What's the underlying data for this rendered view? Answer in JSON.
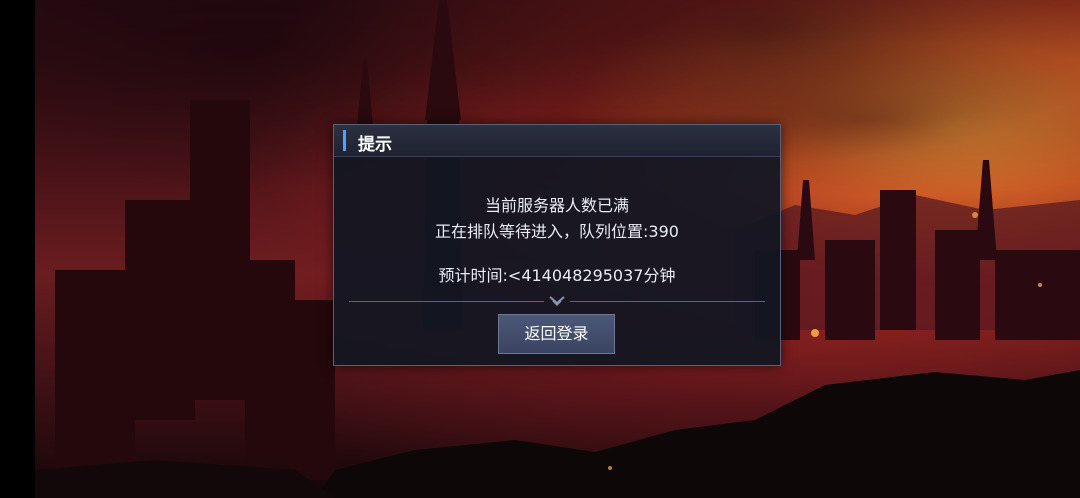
{
  "dialog": {
    "title": "提示",
    "line1": "当前服务器人数已满",
    "line2": "正在排队等待进入，队列位置:390",
    "line3": "预计时间:<414048295037分钟",
    "return_button": "返回登录"
  },
  "colors": {
    "accent": "#4fa3ff",
    "dialog_bg": "#121622",
    "button_bg": "#3f4a68"
  },
  "icons": {
    "divider": "chevron-down-icon"
  }
}
